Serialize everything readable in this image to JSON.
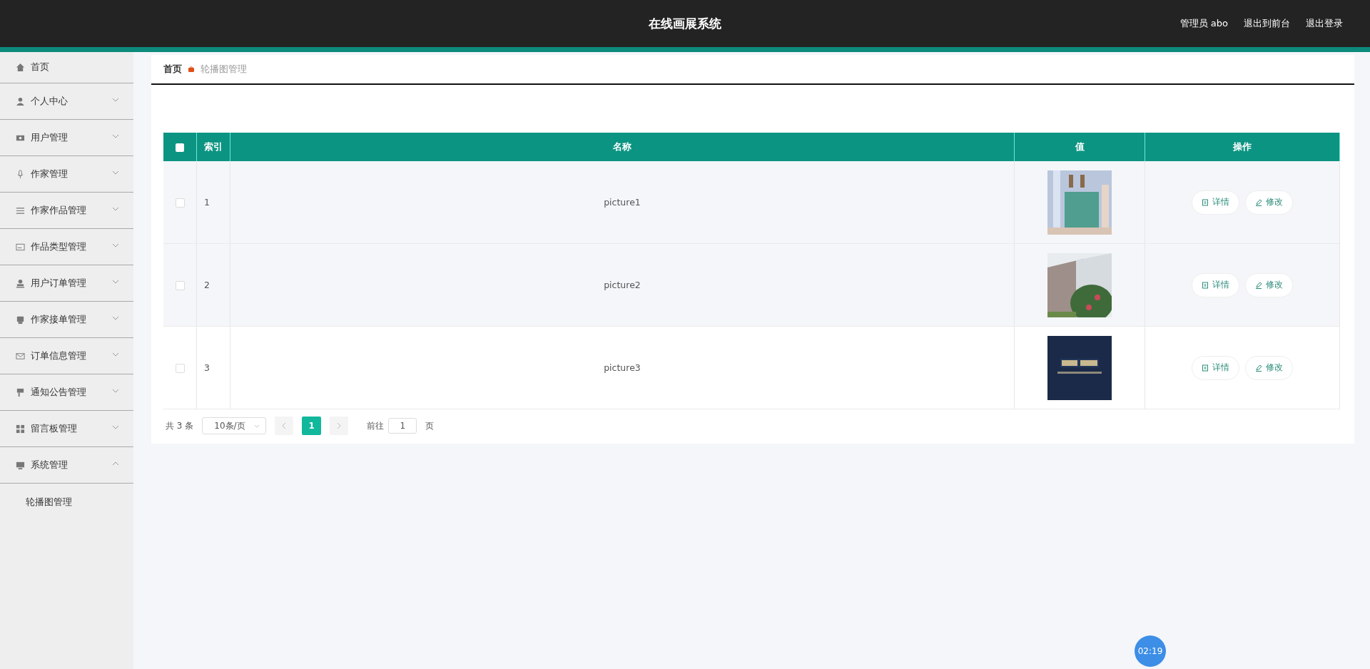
{
  "header": {
    "title": "在线画展系统",
    "links": [
      "管理员 abo",
      "退出到前台",
      "退出登录"
    ]
  },
  "sidebar": {
    "items": [
      {
        "label": "首页",
        "kind": "link"
      },
      {
        "label": "个人中心",
        "kind": "group",
        "expanded": false
      },
      {
        "label": "用户管理",
        "kind": "group",
        "expanded": false
      },
      {
        "label": "作家管理",
        "kind": "group",
        "expanded": false
      },
      {
        "label": "作家作品管理",
        "kind": "group",
        "expanded": false
      },
      {
        "label": "作品类型管理",
        "kind": "group",
        "expanded": false
      },
      {
        "label": "用户订单管理",
        "kind": "group",
        "expanded": false
      },
      {
        "label": "作家接单管理",
        "kind": "group",
        "expanded": false
      },
      {
        "label": "订单信息管理",
        "kind": "group",
        "expanded": false
      },
      {
        "label": "通知公告管理",
        "kind": "group",
        "expanded": false
      },
      {
        "label": "留言板管理",
        "kind": "group",
        "expanded": false
      },
      {
        "label": "系统管理",
        "kind": "group",
        "expanded": true,
        "children": [
          {
            "label": "轮播图管理"
          }
        ]
      }
    ]
  },
  "breadcrumb": [
    "首页",
    "轮播图管理"
  ],
  "table": {
    "all_checked": false,
    "columns": [
      "索引",
      "名称",
      "值",
      "操作"
    ],
    "rows": [
      {
        "index": "1",
        "name": "picture1",
        "value": {
          "kind": "picture"
        },
        "checked": false,
        "actions": [
          "详情",
          "修改"
        ]
      },
      {
        "index": "2",
        "name": "picture2",
        "value": {
          "kind": "picture"
        },
        "checked": false,
        "actions": [
          "详情",
          "修改"
        ]
      },
      {
        "index": "3",
        "name": "picture3",
        "value": {
          "kind": "picture"
        },
        "checked": false,
        "actions": [
          "详情",
          "修改"
        ]
      }
    ]
  },
  "pagination": {
    "total": "共 3 条",
    "page_size": "10条/页",
    "pages": [
      {
        "label": "1",
        "selected": true
      }
    ],
    "goto_label": "前往",
    "goto_value": "1",
    "goto_suffix": "页"
  },
  "timer": "02:19"
}
